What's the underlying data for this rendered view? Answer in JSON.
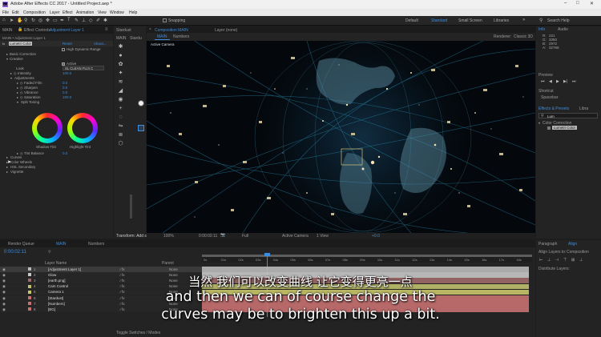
{
  "window": {
    "title": "Adobe After Effects CC 2017 - Untitled Project.aep *",
    "controls": [
      "–",
      "□",
      "✕"
    ]
  },
  "menubar": [
    "File",
    "Edit",
    "Composition",
    "Layer",
    "Effect",
    "Animation",
    "View",
    "Window",
    "Help"
  ],
  "toolbar": {
    "snapping": "Snapping",
    "workspaces": [
      "Default",
      "Standard",
      "Small Screen",
      "Libraries"
    ],
    "search": "Search Help"
  },
  "left_panel": {
    "tabs": [
      "MAIN",
      "Effect Controls",
      "Adjustment Layer 1"
    ],
    "subtitle": "MAIN • Adjustment Layer 1",
    "effect_name": "Lumetri Color",
    "reset": "Reset",
    "about": "About...",
    "rows": [
      {
        "label": "",
        "value": "High Dynamic Range",
        "kind": "check"
      },
      {
        "label": "Basic Correction",
        "value": "",
        "kind": "group"
      },
      {
        "label": "Creative",
        "value": "",
        "kind": "group"
      },
      {
        "label": "",
        "value": "Active",
        "kind": "check"
      },
      {
        "label": "Look",
        "value": "SL CLEAN FUJI C",
        "kind": "select"
      },
      {
        "label": "Intensity",
        "value": "100.0",
        "kind": "value"
      },
      {
        "label": "Adjustments",
        "value": "",
        "kind": "group"
      },
      {
        "label": "Faded Film",
        "value": "0.0",
        "kind": "value"
      },
      {
        "label": "Sharpen",
        "value": "0.0",
        "kind": "value"
      },
      {
        "label": "Vibrance",
        "value": "0.0",
        "kind": "value"
      },
      {
        "label": "Saturation",
        "value": "100.0",
        "kind": "value"
      },
      {
        "label": "Split Toning",
        "value": "",
        "kind": "group"
      }
    ],
    "wheel_labels": [
      "Shadow Tint",
      "Highlight Tint"
    ],
    "tint_balance": {
      "label": "Tint Balance",
      "value": "0.0"
    },
    "groups": [
      "Curves",
      "Color Wheels",
      "HSL Secondary",
      "Vignette"
    ]
  },
  "viewer": {
    "tabs": [
      "Stardust",
      "MAIN",
      "Stardu"
    ],
    "comp_tab": "Composition MAIN",
    "layer_tab": "Layer (none)",
    "sub_tabs": [
      "MAIN",
      "Numbers"
    ],
    "renderer": "Renderer:",
    "renderer_value": "Classic 3D",
    "camera_label": "Active Camera",
    "footer": {
      "transform": "Transform: Add s",
      "zoom": "100%",
      "time": "0:00:02:11",
      "quality": "Full",
      "camera": "Active Camera",
      "view": "1 View",
      "offset": "+0.0"
    }
  },
  "right_panel": {
    "info_tabs": [
      "Info",
      "Audio"
    ],
    "info": [
      {
        "k": "R:",
        "v": "221"
      },
      {
        "k": "G:",
        "v": "3350"
      },
      {
        "k": "B:",
        "v": "2972"
      },
      {
        "k": "A:",
        "v": "32768"
      }
    ],
    "preview": "Preview",
    "shortcut": "Shortcut",
    "shortcut_value": "Spacebar",
    "effects_tabs": [
      "Effects & Presets",
      "Libra"
    ],
    "effects_search": "Lum",
    "effects_tree": [
      "Color Correction",
      "Lumetri Color"
    ],
    "paragraph_tabs": [
      "Paragraph",
      "Align"
    ],
    "align_to": "Align Layers to:",
    "align_value": "Composition",
    "distribute": "Distribute Layers:"
  },
  "timeline": {
    "tabs": [
      "Render Queue",
      "MAIN",
      "Numbers"
    ],
    "time": "0:00:02:11",
    "header": [
      "Layer Name",
      "Parent"
    ],
    "layers": [
      {
        "num": "1",
        "name": "[Adjustment Layer 1]",
        "color": "#b9b9b9",
        "parent": "None"
      },
      {
        "num": "2",
        "name": "Glow",
        "color": "#c8c8c8",
        "parent": "None"
      },
      {
        "num": "3",
        "name": "[earth.png]",
        "color": "#a06a6a",
        "parent": "None"
      },
      {
        "num": "4",
        "name": "Cam Control",
        "color": "#c1c16d",
        "parent": "None"
      },
      {
        "num": "5",
        "name": "Camera 1",
        "color": "#c9c66a",
        "parent": "None"
      },
      {
        "num": "6",
        "name": "[Stardust]",
        "color": "#c67170",
        "parent": "None"
      },
      {
        "num": "7",
        "name": "[Numbers]",
        "color": "#c67170",
        "parent": "None"
      },
      {
        "num": "8",
        "name": "[BG]",
        "color": "#c67170",
        "parent": "None"
      }
    ],
    "ruler": [
      "0s",
      "01s",
      "02s",
      "03s",
      "04s",
      "05s",
      "06s",
      "07s",
      "08s",
      "09s",
      "10s",
      "11s",
      "12s",
      "13s",
      "14s",
      "15s",
      "16s",
      "17s",
      "18s"
    ],
    "footer": "Toggle Switches / Modes"
  },
  "subtitles": {
    "zh": "当然 我们可以改变曲线 让它变得更亮一点",
    "en1": "and then we can of course change the",
    "en2": "curves may be to brighten this up a bit."
  },
  "colors": {
    "accent": "#3c8dde",
    "panel": "#232323",
    "bg": "#1d1d1d"
  }
}
